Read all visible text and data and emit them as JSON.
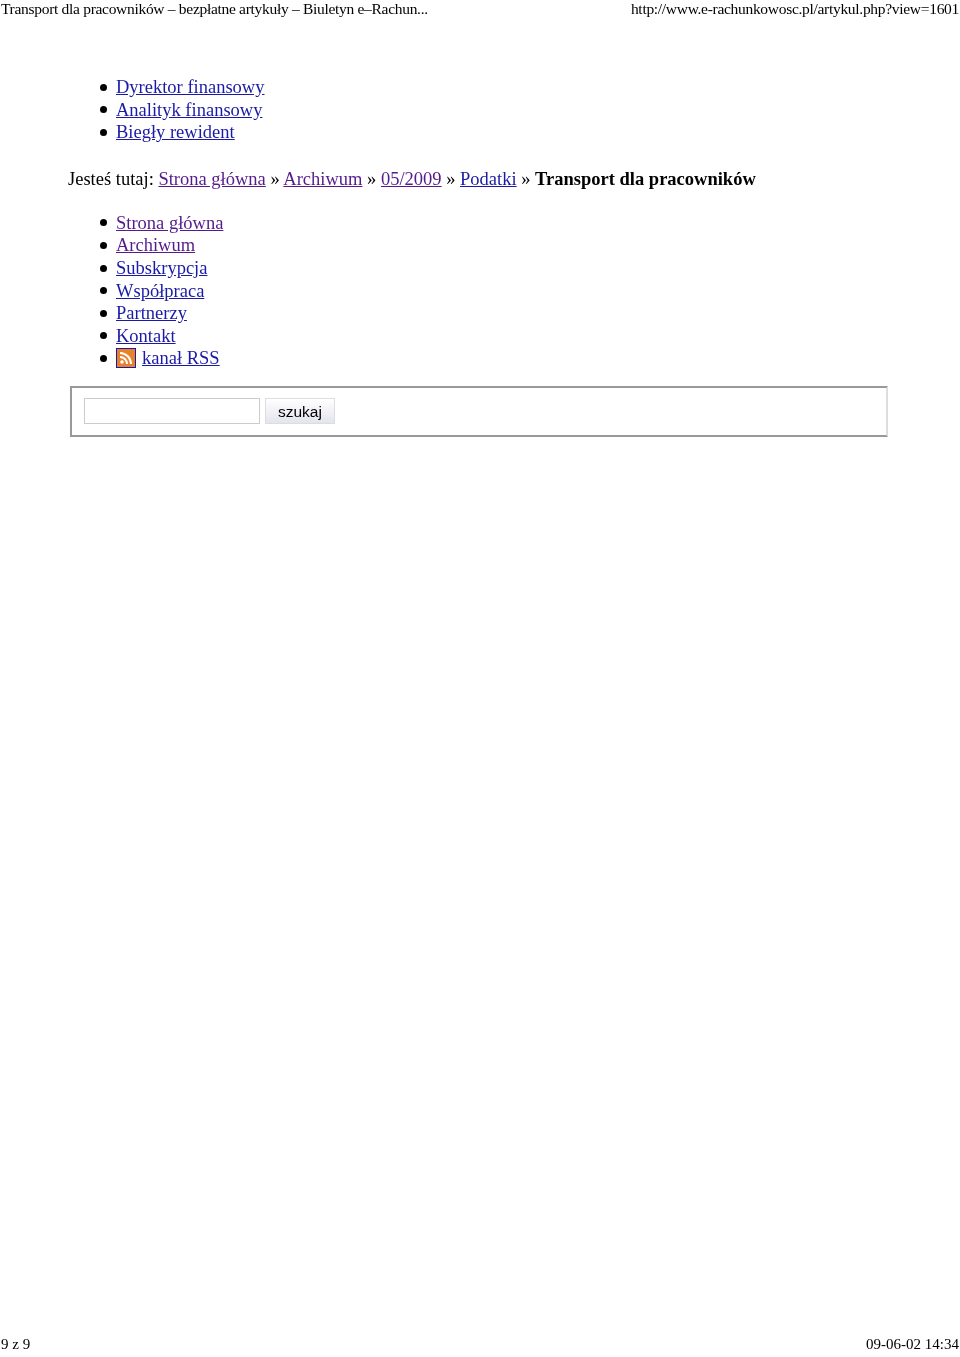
{
  "print_header": {
    "title": "Transport dla pracowników – bezpłatne artykuły – Biuletyn e–Rachun...",
    "url": "http://www.e-rachunkowosc.pl/artykul.php?view=1601"
  },
  "top_links": [
    {
      "label": "Dyrektor finansowy",
      "visited": false
    },
    {
      "label": "Analityk finansowy",
      "visited": false
    },
    {
      "label": "Biegły rewident",
      "visited": false
    }
  ],
  "breadcrumb": {
    "prefix": "Jesteś tutaj:",
    "separator": "»",
    "links": [
      {
        "label": "Strona główna",
        "visited": true
      },
      {
        "label": "Archiwum",
        "visited": true
      },
      {
        "label": "05/2009",
        "visited": true
      },
      {
        "label": "Podatki",
        "visited": false
      }
    ],
    "current": "Transport dla pracowników"
  },
  "menu": [
    {
      "label": "Strona główna",
      "visited": true,
      "kind": "link"
    },
    {
      "label": "Archiwum",
      "visited": true,
      "kind": "link"
    },
    {
      "label": "Subskrypcja",
      "visited": false,
      "kind": "link"
    },
    {
      "label": "Współpraca",
      "visited": false,
      "kind": "link"
    },
    {
      "label": "Partnerzy",
      "visited": false,
      "kind": "link"
    },
    {
      "label": "Kontakt",
      "visited": false,
      "kind": "link"
    },
    {
      "label": "kanał RSS",
      "visited": false,
      "kind": "rss"
    }
  ],
  "search": {
    "button": "szukaj"
  },
  "print_footer": {
    "page": "9 z 9",
    "datetime": "09-06-02 14:34"
  }
}
